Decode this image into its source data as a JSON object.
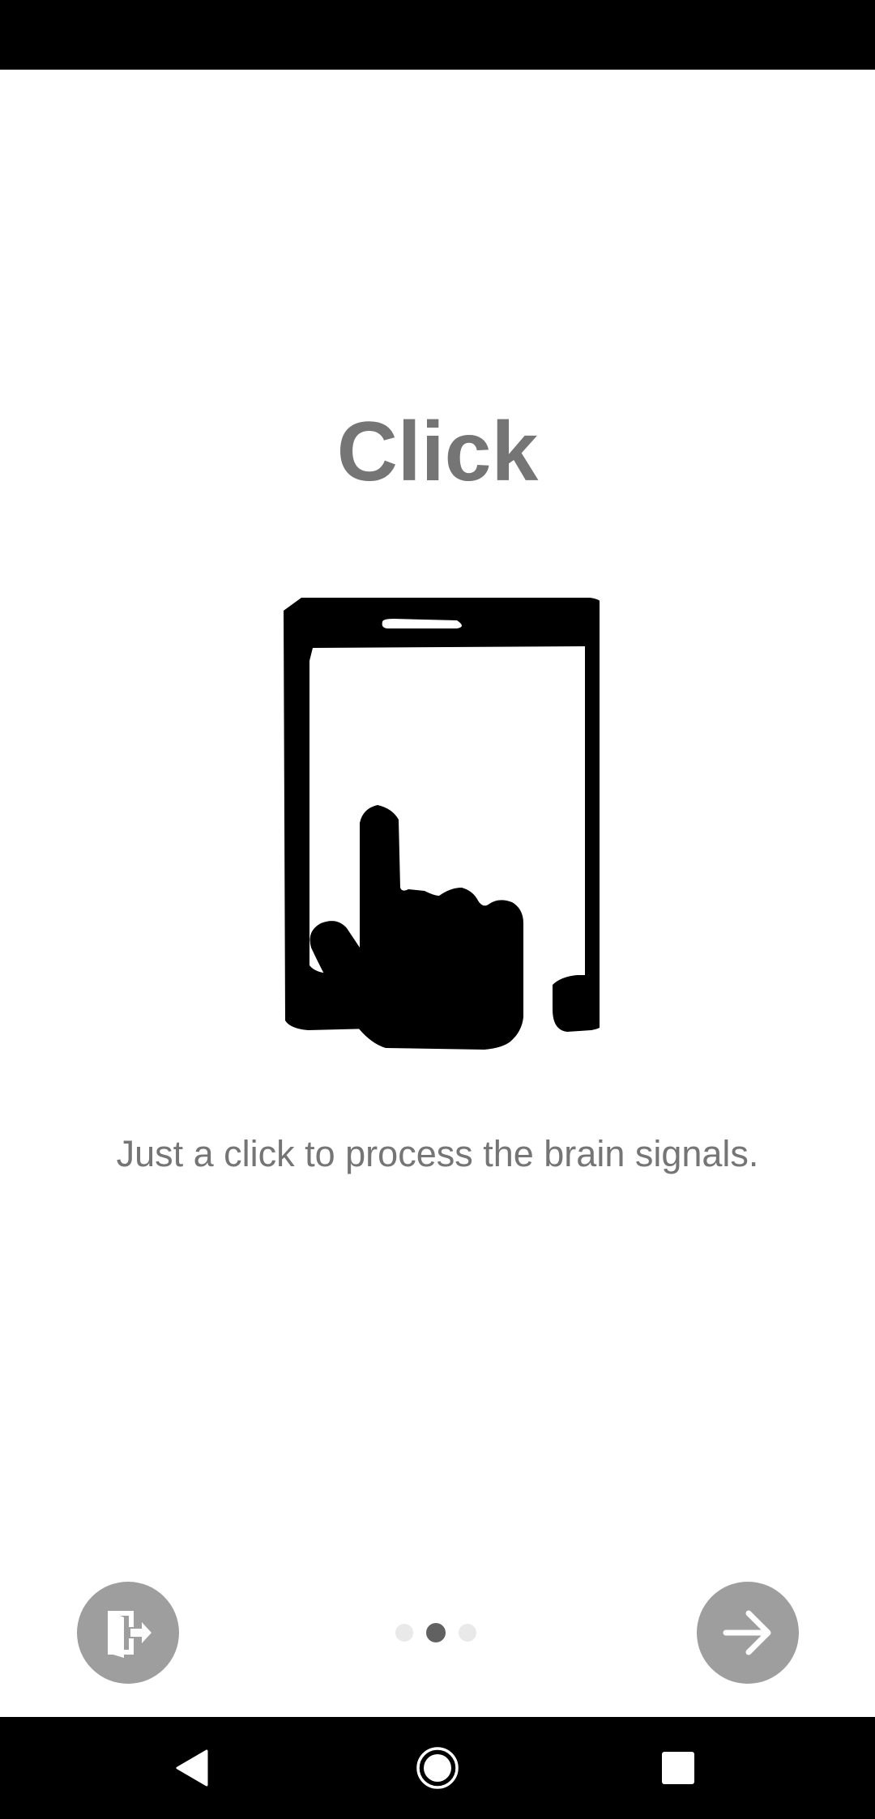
{
  "onboarding": {
    "title": "Click",
    "description": "Just a click to process the brain signals.",
    "illustration_icon": "tablet-tap-icon",
    "exit_icon": "exit-door-icon",
    "next_icon": "arrow-right-icon",
    "page_count": 3,
    "current_page": 2
  },
  "navigation": {
    "back_icon": "back-triangle-icon",
    "home_icon": "home-circle-icon",
    "recents_icon": "recents-square-icon"
  },
  "colors": {
    "title": "#757575",
    "description": "#757575",
    "button_bg": "#9e9e9e",
    "dot_active": "#616161",
    "dot_inactive": "#e9e9e9",
    "system_bars": "#000000"
  }
}
